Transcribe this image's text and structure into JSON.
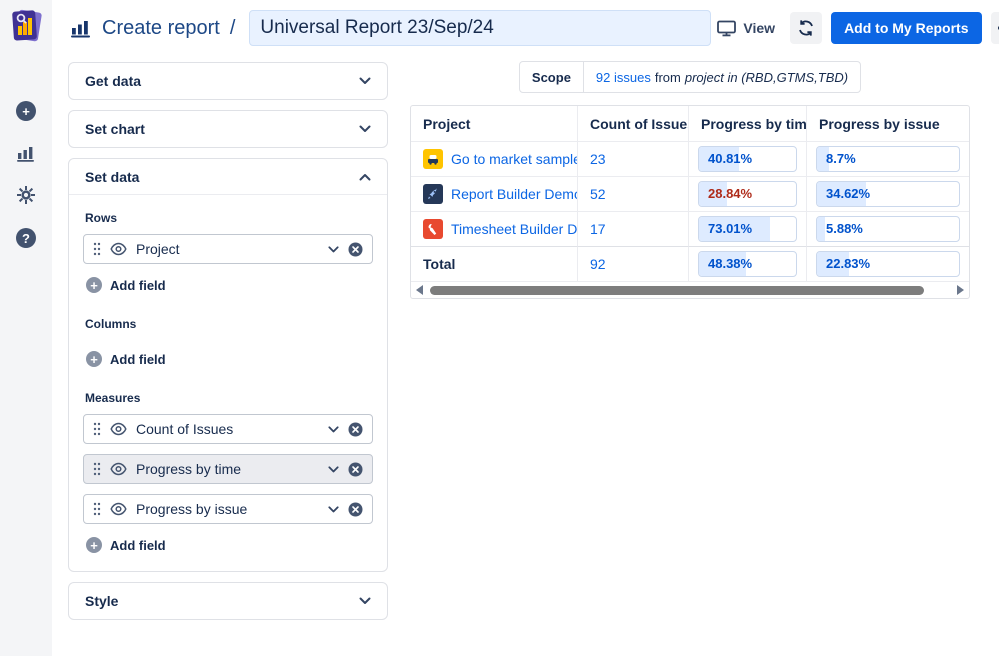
{
  "app": {
    "logo_icon": "report-builder-logo"
  },
  "header": {
    "breadcrumb": "Create report",
    "separator": "/",
    "title_value": "Universal Report 23/Sep/24",
    "view_label": "View",
    "add_button_label": "Add to My Reports"
  },
  "sidebar": {
    "icons": [
      "plus-icon",
      "bar-chart-icon",
      "gear-icon",
      "help-icon"
    ],
    "plus_glyph": "+",
    "help_glyph": "?"
  },
  "panel": {
    "accordions": [
      {
        "label": "Get data",
        "expanded": false
      },
      {
        "label": "Set chart",
        "expanded": false
      },
      {
        "label": "Set data",
        "expanded": true
      },
      {
        "label": "Style",
        "expanded": false
      }
    ],
    "set_data": {
      "rows_label": "Rows",
      "columns_label": "Columns",
      "measures_label": "Measures",
      "add_field_label": "Add field",
      "row_fields": [
        {
          "label": "Project",
          "selected": false
        }
      ],
      "measure_fields": [
        {
          "label": "Count of Issues",
          "selected": false
        },
        {
          "label": "Progress by time",
          "selected": true
        },
        {
          "label": "Progress by issue",
          "selected": false
        }
      ]
    }
  },
  "scope": {
    "label": "Scope",
    "issues_link": "92 issues",
    "from_text": "from",
    "filter_text": "project in (RBD,GTMS,TBD)"
  },
  "table": {
    "columns": [
      "Project",
      "Count of Issues",
      "Progress by time",
      "Progress by issue"
    ],
    "rows": [
      {
        "project": "Go to market sample",
        "avatar_icon": "go-to-market-avatar",
        "avatar_bg": "#FFC400",
        "count": "23",
        "progress_time": {
          "label": "40.81%",
          "value": 40.81,
          "color": "#0052CC"
        },
        "progress_issue": {
          "label": "8.7%",
          "value": 8.7,
          "color": "#0052CC"
        }
      },
      {
        "project": "Report Builder Demo",
        "avatar_icon": "rocket-avatar",
        "avatar_bg": "#253858",
        "count": "52",
        "progress_time": {
          "label": "28.84%",
          "value": 28.84,
          "color": "#AE2A19"
        },
        "progress_issue": {
          "label": "34.62%",
          "value": 34.62,
          "color": "#0052CC"
        }
      },
      {
        "project": "Timesheet Builder Demo",
        "avatar_icon": "wrench-avatar",
        "avatar_bg": "#E8492F",
        "count": "17",
        "progress_time": {
          "label": "73.01%",
          "value": 73.01,
          "color": "#0052CC"
        },
        "progress_issue": {
          "label": "5.88%",
          "value": 5.88,
          "color": "#0052CC"
        }
      }
    ],
    "total": {
      "label": "Total",
      "count": "92",
      "progress_time": {
        "label": "48.38%",
        "value": 48.38,
        "color": "#0052CC"
      },
      "progress_issue": {
        "label": "22.83%",
        "value": 22.83,
        "color": "#0052CC"
      }
    }
  },
  "colors": {
    "accent_blue": "#0C66E4",
    "negative_red": "#AE2A19",
    "progress_fill": "#DEEBFF",
    "rail_bg": "#F4F5F7"
  }
}
